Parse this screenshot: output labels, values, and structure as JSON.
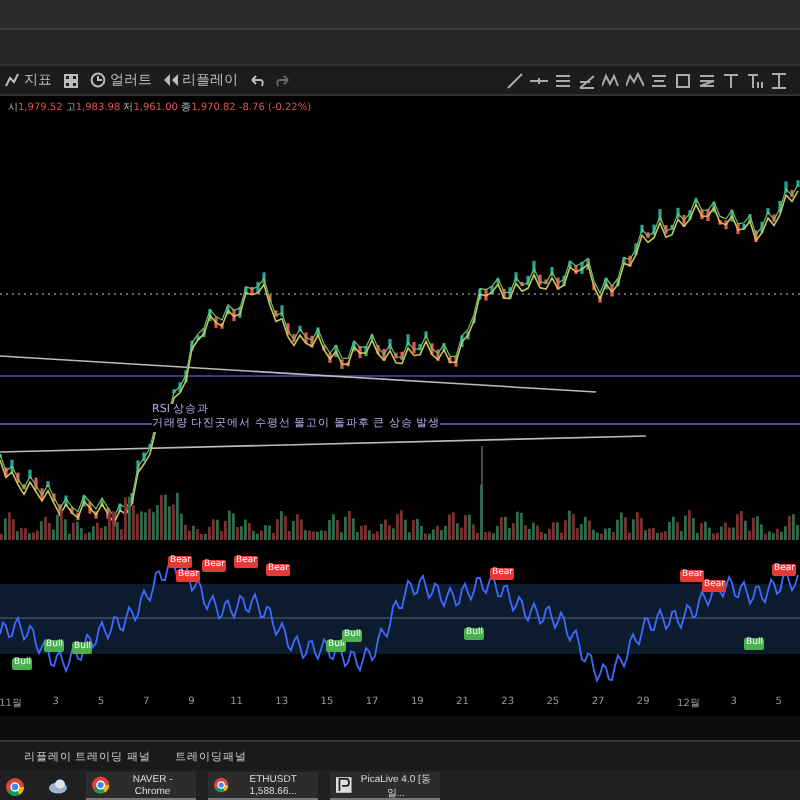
{
  "toolbar": {
    "items": [
      {
        "kind": "indicators",
        "label": "지표"
      },
      {
        "kind": "templates"
      },
      {
        "kind": "alert",
        "label": "얼러트"
      },
      {
        "kind": "replay",
        "label": "리플레이"
      },
      {
        "kind": "undo"
      },
      {
        "kind": "redo"
      }
    ]
  },
  "legend": {
    "open_label": "시",
    "open": "1,979.52",
    "high_label": "고",
    "high": "1,983.98",
    "low_label": "저",
    "low": "1,961.00",
    "close_label": "종",
    "close": "1,970.82",
    "change": "-8.76 (-0.22%)"
  },
  "annotation": [
    "RSI 상승과",
    "거래량 다진곳에서 수평선 몰고이 돌파후 큰 상승 발생"
  ],
  "signals": [
    {
      "kind": "bull",
      "label": "Bull"
    },
    {
      "kind": "bull",
      "label": "Bull"
    },
    {
      "kind": "bull",
      "label": "Bull"
    },
    {
      "kind": "bear",
      "label": "Bear"
    },
    {
      "kind": "bear",
      "label": "Bear"
    },
    {
      "kind": "bear",
      "label": "Bear"
    },
    {
      "kind": "bear",
      "label": "Bear"
    },
    {
      "kind": "bear",
      "label": "Bear"
    },
    {
      "kind": "bull",
      "label": "Bull"
    },
    {
      "kind": "bull",
      "label": "Bull"
    },
    {
      "kind": "bull",
      "label": "Bull"
    },
    {
      "kind": "bear",
      "label": "Bear"
    },
    {
      "kind": "bear",
      "label": "Bear"
    },
    {
      "kind": "bear",
      "label": "Bear"
    },
    {
      "kind": "bull",
      "label": "Bull"
    },
    {
      "kind": "bear",
      "label": "Bear"
    }
  ],
  "time_axis": [
    "11월",
    "3",
    "5",
    "7",
    "9",
    "11",
    "13",
    "15",
    "17",
    "19",
    "21",
    "23",
    "25",
    "27",
    "29",
    "12월",
    "3",
    "5"
  ],
  "bottom_tabs": [
    "리플레이 트레이딩 패널",
    "트레이딩패널"
  ],
  "taskbar": [
    {
      "kind": "chrome"
    },
    {
      "kind": "app"
    },
    {
      "kind": "chrome",
      "label": "NAVER - Chrome"
    },
    {
      "kind": "chrome",
      "label": "ETHUSDT 1,588.66..."
    },
    {
      "kind": "pica",
      "label": "PicaLive 4.0 [동일..."
    }
  ]
}
